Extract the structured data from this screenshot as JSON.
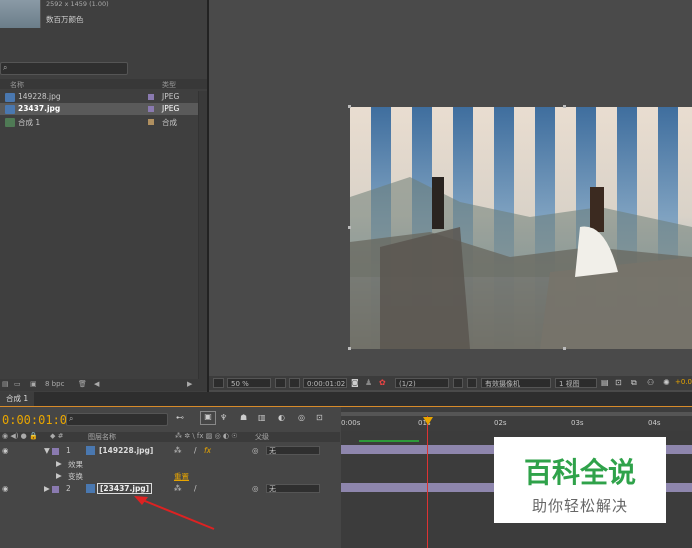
{
  "project": {
    "meta_line1": "2592 x 1459 (1.00)",
    "meta_line2": "数百万颜色",
    "search_placeholder": "",
    "col_name": "名称",
    "col_type": "类型",
    "items": [
      {
        "name": "149228.jpg",
        "type": "JPEG",
        "color": "#8a7ab0"
      },
      {
        "name": "23437.jpg",
        "type": "JPEG",
        "color": "#8a7ab0"
      },
      {
        "name": "合成 1",
        "type": "合成",
        "color": "#b09060"
      }
    ],
    "bpc": "8 bpc"
  },
  "viewer": {
    "zoom": "50 %",
    "timecode": "0:00:01:02",
    "resolution": "(1/2)",
    "camera": "有效摄像机",
    "views": "1 视图",
    "exposure": "+0.0"
  },
  "timeline": {
    "tab": "合成 1",
    "timecode": "0:00:01:02",
    "col_source": "图层名称",
    "col_parent": "父级",
    "ruler": [
      "0:00s",
      "01s",
      "02s",
      "03s",
      "04s"
    ],
    "layers": [
      {
        "index": "1",
        "name": "[149228.jpg]",
        "parent": "无"
      },
      {
        "index": "2",
        "name": "[23437.jpg]",
        "parent": "无"
      }
    ],
    "sub_effects": "效果",
    "sub_transform": "变换",
    "sub_reset": "重置"
  },
  "watermark": {
    "title": "百科全说",
    "subtitle": "助你轻松解决"
  }
}
